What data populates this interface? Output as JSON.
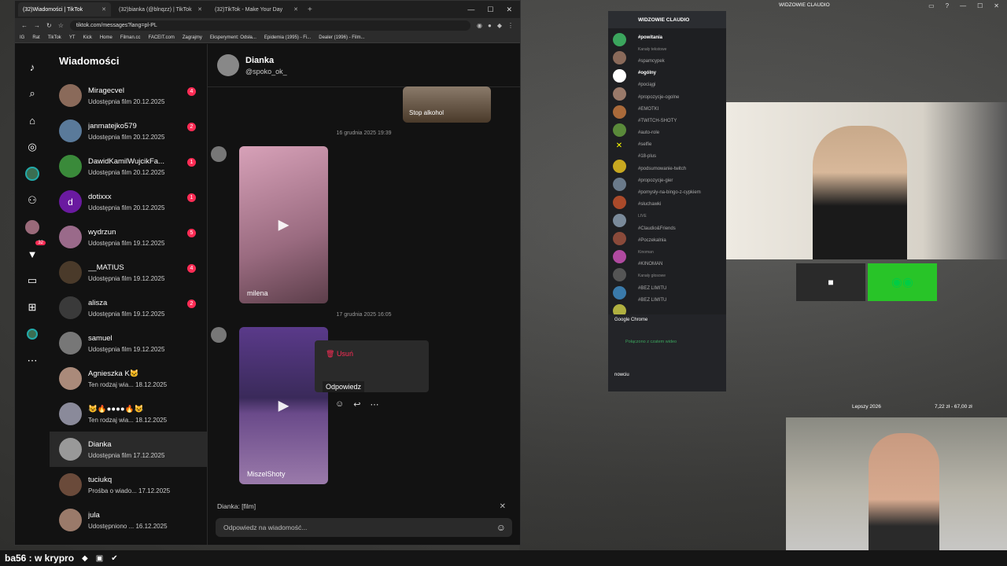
{
  "browser": {
    "tabs": [
      "(32)Wiadomości | TikTok",
      "(32)bianka (@blnqzz) | TikTok",
      "(32)TikTok - Make Your Day"
    ],
    "url": "tiktok.com/messages?lang=pl-PL",
    "bookmarks": [
      "IG",
      "Rat",
      "TikTok",
      "YT",
      "Kick",
      "Home",
      "Filman.cc",
      "FACEIT.com",
      "Zagrajmy",
      "Eksperyment: Odsła...",
      "Epidemia (1995) - Fi...",
      "Dealer (1996) - Film..."
    ]
  },
  "sidebar_title": "Wiadomości",
  "conversations": [
    {
      "name": "Miragecvel",
      "sub": "Udostępnia film 20.12.2025",
      "count": "4",
      "color": "#8a6a5a"
    },
    {
      "name": "janmatejko579",
      "sub": "Udostępnia film 20.12.2025",
      "count": "2",
      "color": "#5a7a9a"
    },
    {
      "name": "DawidKamilWujcikFa...",
      "sub": "Udostępnia film 20.12.2025",
      "count": "1",
      "color": "#3a8a3a"
    },
    {
      "name": "dotixxx",
      "sub": "Udostępnia film 20.12.2025",
      "count": "1",
      "color": "#6a1aa0",
      "initial": "d"
    },
    {
      "name": "wydrzun",
      "sub": "Udostępnia film 19.12.2025",
      "count": "5",
      "color": "#9a6a8a"
    },
    {
      "name": "__MATIUS",
      "sub": "Udostępnia film 19.12.2025",
      "count": "4",
      "color": "#4a3a2a"
    },
    {
      "name": "alisza",
      "sub": "Udostępnia film 19.12.2025",
      "count": "2",
      "color": "#3a3a3a"
    },
    {
      "name": "samuel",
      "sub": "Udostępnia film 19.12.2025",
      "count": "",
      "color": "#777"
    },
    {
      "name": "Agnieszka K🐱",
      "sub": "Ten rodzaj wia... 18.12.2025",
      "count": "",
      "color": "#aa8a7a"
    },
    {
      "name": "😺🔥●●●●🔥😺",
      "sub": "Ten rodzaj wia... 18.12.2025",
      "count": "",
      "color": "#8a8a9a"
    },
    {
      "name": "Dianka",
      "sub": "Udostępnia film 17.12.2025",
      "count": "",
      "color": "#999"
    },
    {
      "name": "tuciukq",
      "sub": "Prośba o wiado... 17.12.2025",
      "count": "",
      "color": "#6a4a3a"
    },
    {
      "name": "jula",
      "sub": "Udostępniono ... 16.12.2025",
      "count": "",
      "color": "#9a7a6a"
    }
  ],
  "chat": {
    "name": "Dianka",
    "handle": "@spoko_ok_",
    "video1_label": "Stop alkohol",
    "date1": "16 grudnia 2025 19:39",
    "video2_label": "milena",
    "date2": "17 grudnia 2025 16:05",
    "video3_label": "MiszelShoty",
    "menu_delete": "Usuń",
    "menu_reply": "Odpowiedz",
    "reply_to": "Dianka: [film]",
    "input_placeholder": "Odpowiedz na wiadomość..."
  },
  "discord": {
    "server": "WIDZOWIE CLAUDIO",
    "channels": [
      "powitania",
      "Kanały tekstowe",
      "spamcypek",
      "ogólny",
      "pociągi",
      "propozycje-ogolne",
      "EMOTKI",
      "TWITCH-SHOTY",
      "auto-role",
      "selfie",
      "18-plus",
      "podsumowanie-twitch",
      "propozycje-gier",
      "pomysły-na-bingo-z-cypkiem",
      "słuchawki",
      "LIVE",
      "Claudio&Friends",
      "Poczekalnia",
      "Kinoman",
      "KINOMAN",
      "Kanały głosowe",
      "BEZ LIMITU",
      "BEZ LIMITU"
    ],
    "app": "Google Chrome",
    "voice_status": "Połączono z czatem wideo",
    "user": "nowciu"
  },
  "overlay": {
    "top_title": "WIDZOWIE CLAUDIO",
    "goal": "Lepszy 2026",
    "money": "7,22 zł - 67,00 zł"
  },
  "taskbar_text": "ba56 : w krypro"
}
